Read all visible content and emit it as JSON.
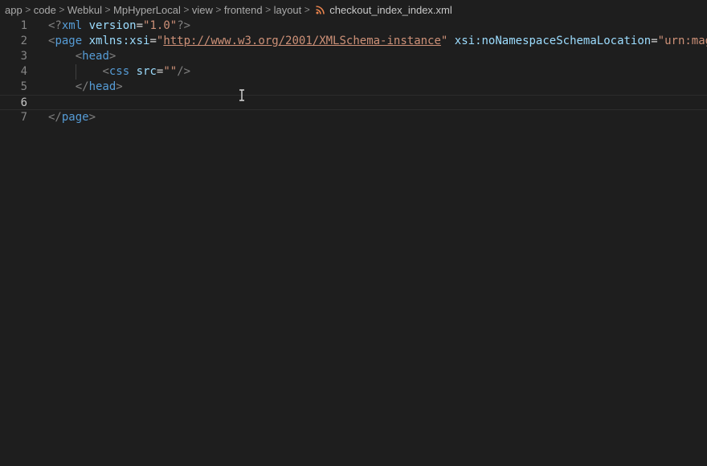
{
  "breadcrumb": {
    "items": [
      "app",
      "code",
      "Webkul",
      "MpHyperLocal",
      "view",
      "frontend",
      "layout"
    ],
    "separator": ">",
    "file": "checkout_index_index.xml",
    "file_icon": "rss-icon"
  },
  "editor": {
    "current_line": 6,
    "lines": [
      {
        "num": "1",
        "tokens": [
          {
            "t": "<?",
            "c": "t-proc"
          },
          {
            "t": "xml",
            "c": "t-tag"
          },
          {
            "t": " ",
            "c": ""
          },
          {
            "t": "version",
            "c": "t-attr"
          },
          {
            "t": "=",
            "c": "t-eq"
          },
          {
            "t": "\"1.0\"",
            "c": "t-str"
          },
          {
            "t": "?>",
            "c": "t-proc"
          }
        ]
      },
      {
        "num": "2",
        "tokens": [
          {
            "t": "<",
            "c": "t-bracket"
          },
          {
            "t": "page",
            "c": "t-tag"
          },
          {
            "t": " ",
            "c": ""
          },
          {
            "t": "xmlns:xsi",
            "c": "t-attr"
          },
          {
            "t": "=",
            "c": "t-eq"
          },
          {
            "t": "\"",
            "c": "t-str"
          },
          {
            "t": "http://www.w3.org/2001/XMLSchema-instance",
            "c": "t-url"
          },
          {
            "t": "\"",
            "c": "t-str"
          },
          {
            "t": " ",
            "c": ""
          },
          {
            "t": "xsi:noNamespaceSchemaLocation",
            "c": "t-attr"
          },
          {
            "t": "=",
            "c": "t-eq"
          },
          {
            "t": "\"urn:mag",
            "c": "t-str"
          }
        ]
      },
      {
        "num": "3",
        "tokens": [
          {
            "t": "    ",
            "c": ""
          },
          {
            "t": "<",
            "c": "t-bracket"
          },
          {
            "t": "head",
            "c": "t-tag"
          },
          {
            "t": ">",
            "c": "t-bracket"
          }
        ]
      },
      {
        "num": "4",
        "tokens": [
          {
            "t": "        ",
            "c": ""
          },
          {
            "t": "<",
            "c": "t-bracket"
          },
          {
            "t": "css",
            "c": "t-tag"
          },
          {
            "t": " ",
            "c": ""
          },
          {
            "t": "src",
            "c": "t-attr"
          },
          {
            "t": "=",
            "c": "t-eq"
          },
          {
            "t": "\"\"",
            "c": "t-str"
          },
          {
            "t": "/>",
            "c": "t-bracket"
          }
        ]
      },
      {
        "num": "5",
        "tokens": [
          {
            "t": "    ",
            "c": ""
          },
          {
            "t": "</",
            "c": "t-bracket"
          },
          {
            "t": "head",
            "c": "t-tag"
          },
          {
            "t": ">",
            "c": "t-bracket"
          }
        ]
      },
      {
        "num": "6",
        "tokens": []
      },
      {
        "num": "7",
        "tokens": [
          {
            "t": "</",
            "c": "t-bracket"
          },
          {
            "t": "page",
            "c": "t-tag"
          },
          {
            "t": ">",
            "c": "t-bracket"
          }
        ]
      }
    ]
  },
  "colors": {
    "background": "#1e1e1e",
    "tag": "#569cd6",
    "attribute": "#9cdcfe",
    "string": "#ce9178",
    "punctuation": "#808080",
    "line_number": "#858585",
    "rss_icon": "#e8834d"
  }
}
